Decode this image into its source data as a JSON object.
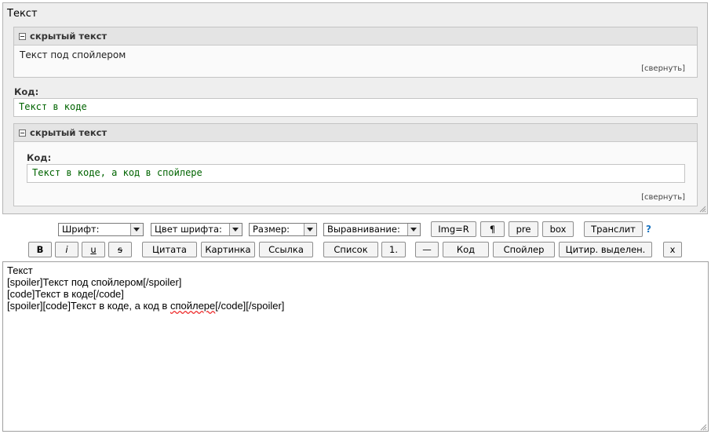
{
  "preview": {
    "title": "Текст",
    "spoiler1": {
      "title": "скрытый текст",
      "body": "Текст под спойлером",
      "collapse": "[свернуть]"
    },
    "code_label": "Код:",
    "code_text": "Текст в коде",
    "spoiler2": {
      "title": "скрытый текст",
      "code_label": "Код:",
      "code_text": "Текст в коде, а код в спойлере",
      "collapse": "[свернуть]"
    }
  },
  "toolbar": {
    "selects": {
      "font": "Шрифт:",
      "color": "Цвет шрифта:",
      "size": "Размер:",
      "align": "Выравнивание:"
    },
    "row1_buttons": {
      "img_r": "Img=R",
      "para": "¶",
      "pre": "pre",
      "box": "box",
      "translit": "Транслит",
      "help": "?"
    },
    "row2_buttons": {
      "bold": "B",
      "italic": "i",
      "underline": "u",
      "strike": "s",
      "quote": "Цитата",
      "image": "Картинка",
      "link": "Ссылка",
      "list": "Список",
      "list_item": "1.",
      "hr": "—",
      "code": "Код",
      "spoiler": "Спойлер",
      "quote_sel": "Цитир. выделен.",
      "close": "x"
    }
  },
  "editor": {
    "line1": "Текст",
    "line2": "[spoiler]Текст под спойлером[/spoiler]",
    "line3": "[code]Текст в коде[/code]",
    "line4_a": "[spoiler][code]Текст в коде, а код в ",
    "line4_spell": "спойлере",
    "line4_b": "[/code][/spoiler]"
  }
}
